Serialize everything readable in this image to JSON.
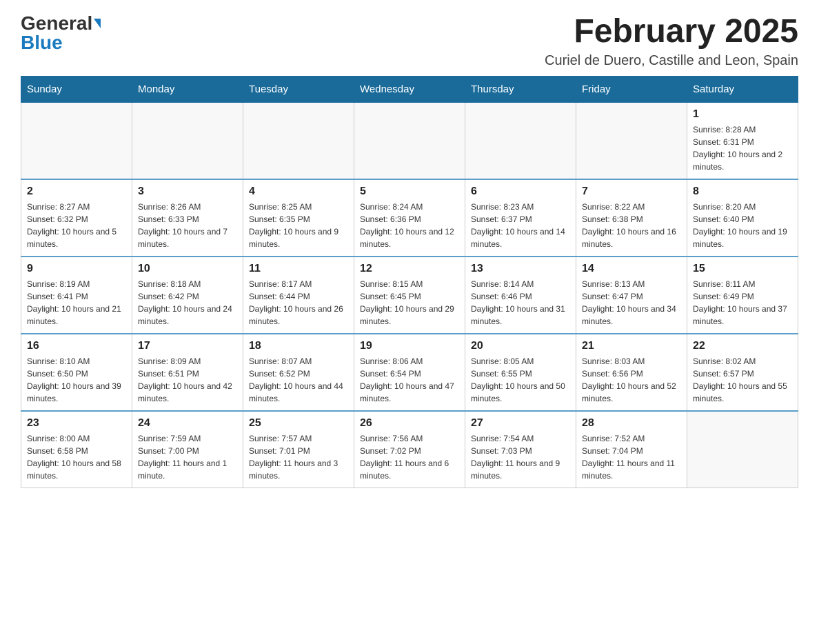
{
  "header": {
    "logo_general": "General",
    "logo_blue": "Blue",
    "month_title": "February 2025",
    "location": "Curiel de Duero, Castille and Leon, Spain"
  },
  "weekdays": [
    "Sunday",
    "Monday",
    "Tuesday",
    "Wednesday",
    "Thursday",
    "Friday",
    "Saturday"
  ],
  "weeks": [
    [
      {
        "day": "",
        "info": ""
      },
      {
        "day": "",
        "info": ""
      },
      {
        "day": "",
        "info": ""
      },
      {
        "day": "",
        "info": ""
      },
      {
        "day": "",
        "info": ""
      },
      {
        "day": "",
        "info": ""
      },
      {
        "day": "1",
        "info": "Sunrise: 8:28 AM\nSunset: 6:31 PM\nDaylight: 10 hours and 2 minutes."
      }
    ],
    [
      {
        "day": "2",
        "info": "Sunrise: 8:27 AM\nSunset: 6:32 PM\nDaylight: 10 hours and 5 minutes."
      },
      {
        "day": "3",
        "info": "Sunrise: 8:26 AM\nSunset: 6:33 PM\nDaylight: 10 hours and 7 minutes."
      },
      {
        "day": "4",
        "info": "Sunrise: 8:25 AM\nSunset: 6:35 PM\nDaylight: 10 hours and 9 minutes."
      },
      {
        "day": "5",
        "info": "Sunrise: 8:24 AM\nSunset: 6:36 PM\nDaylight: 10 hours and 12 minutes."
      },
      {
        "day": "6",
        "info": "Sunrise: 8:23 AM\nSunset: 6:37 PM\nDaylight: 10 hours and 14 minutes."
      },
      {
        "day": "7",
        "info": "Sunrise: 8:22 AM\nSunset: 6:38 PM\nDaylight: 10 hours and 16 minutes."
      },
      {
        "day": "8",
        "info": "Sunrise: 8:20 AM\nSunset: 6:40 PM\nDaylight: 10 hours and 19 minutes."
      }
    ],
    [
      {
        "day": "9",
        "info": "Sunrise: 8:19 AM\nSunset: 6:41 PM\nDaylight: 10 hours and 21 minutes."
      },
      {
        "day": "10",
        "info": "Sunrise: 8:18 AM\nSunset: 6:42 PM\nDaylight: 10 hours and 24 minutes."
      },
      {
        "day": "11",
        "info": "Sunrise: 8:17 AM\nSunset: 6:44 PM\nDaylight: 10 hours and 26 minutes."
      },
      {
        "day": "12",
        "info": "Sunrise: 8:15 AM\nSunset: 6:45 PM\nDaylight: 10 hours and 29 minutes."
      },
      {
        "day": "13",
        "info": "Sunrise: 8:14 AM\nSunset: 6:46 PM\nDaylight: 10 hours and 31 minutes."
      },
      {
        "day": "14",
        "info": "Sunrise: 8:13 AM\nSunset: 6:47 PM\nDaylight: 10 hours and 34 minutes."
      },
      {
        "day": "15",
        "info": "Sunrise: 8:11 AM\nSunset: 6:49 PM\nDaylight: 10 hours and 37 minutes."
      }
    ],
    [
      {
        "day": "16",
        "info": "Sunrise: 8:10 AM\nSunset: 6:50 PM\nDaylight: 10 hours and 39 minutes."
      },
      {
        "day": "17",
        "info": "Sunrise: 8:09 AM\nSunset: 6:51 PM\nDaylight: 10 hours and 42 minutes."
      },
      {
        "day": "18",
        "info": "Sunrise: 8:07 AM\nSunset: 6:52 PM\nDaylight: 10 hours and 44 minutes."
      },
      {
        "day": "19",
        "info": "Sunrise: 8:06 AM\nSunset: 6:54 PM\nDaylight: 10 hours and 47 minutes."
      },
      {
        "day": "20",
        "info": "Sunrise: 8:05 AM\nSunset: 6:55 PM\nDaylight: 10 hours and 50 minutes."
      },
      {
        "day": "21",
        "info": "Sunrise: 8:03 AM\nSunset: 6:56 PM\nDaylight: 10 hours and 52 minutes."
      },
      {
        "day": "22",
        "info": "Sunrise: 8:02 AM\nSunset: 6:57 PM\nDaylight: 10 hours and 55 minutes."
      }
    ],
    [
      {
        "day": "23",
        "info": "Sunrise: 8:00 AM\nSunset: 6:58 PM\nDaylight: 10 hours and 58 minutes."
      },
      {
        "day": "24",
        "info": "Sunrise: 7:59 AM\nSunset: 7:00 PM\nDaylight: 11 hours and 1 minute."
      },
      {
        "day": "25",
        "info": "Sunrise: 7:57 AM\nSunset: 7:01 PM\nDaylight: 11 hours and 3 minutes."
      },
      {
        "day": "26",
        "info": "Sunrise: 7:56 AM\nSunset: 7:02 PM\nDaylight: 11 hours and 6 minutes."
      },
      {
        "day": "27",
        "info": "Sunrise: 7:54 AM\nSunset: 7:03 PM\nDaylight: 11 hours and 9 minutes."
      },
      {
        "day": "28",
        "info": "Sunrise: 7:52 AM\nSunset: 7:04 PM\nDaylight: 11 hours and 11 minutes."
      },
      {
        "day": "",
        "info": ""
      }
    ]
  ]
}
